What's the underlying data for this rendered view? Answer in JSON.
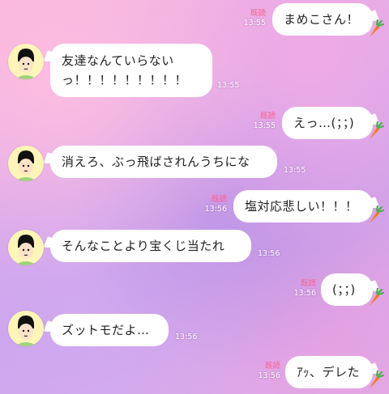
{
  "messages": [
    {
      "id": "m1",
      "side": "right",
      "text": "まめこさん！",
      "read": "既読",
      "time": "13:55"
    },
    {
      "id": "m2",
      "side": "left",
      "lines": [
        "友達なんていらない",
        "っ！！！！！！！！！"
      ],
      "time": "13:55"
    },
    {
      "id": "m3",
      "side": "right",
      "text": "えっ…(；；)",
      "read": "既読",
      "time": "13:55"
    },
    {
      "id": "m4",
      "side": "left",
      "text": "消えろ、ぶっ飛ばされんうちにな",
      "time": "13:55"
    },
    {
      "id": "m5",
      "side": "right",
      "text": "塩対応悲しい！！！",
      "read": "既読",
      "time": "13:56"
    },
    {
      "id": "m6",
      "side": "left",
      "text": "そんなことより宝くじ当たれ",
      "time": "13:56"
    },
    {
      "id": "m7",
      "side": "right",
      "text": "(；；)",
      "read": "既読",
      "time": "13:56"
    },
    {
      "id": "m8",
      "side": "left",
      "text": "ズットモだよ…",
      "time": "13:56"
    },
    {
      "id": "m9",
      "side": "right",
      "text": "ｱｯ、デレた",
      "read": "既読",
      "time": "13:56"
    }
  ],
  "icons": {
    "avatar": "avatar-cartoon-face-icon",
    "sticker": "carrot-icon"
  },
  "colors": {
    "read_receipt": "#ff5e8e",
    "bubble": "#ffffff",
    "carrot": "#f07a1e",
    "leaf": "#4caf50"
  }
}
